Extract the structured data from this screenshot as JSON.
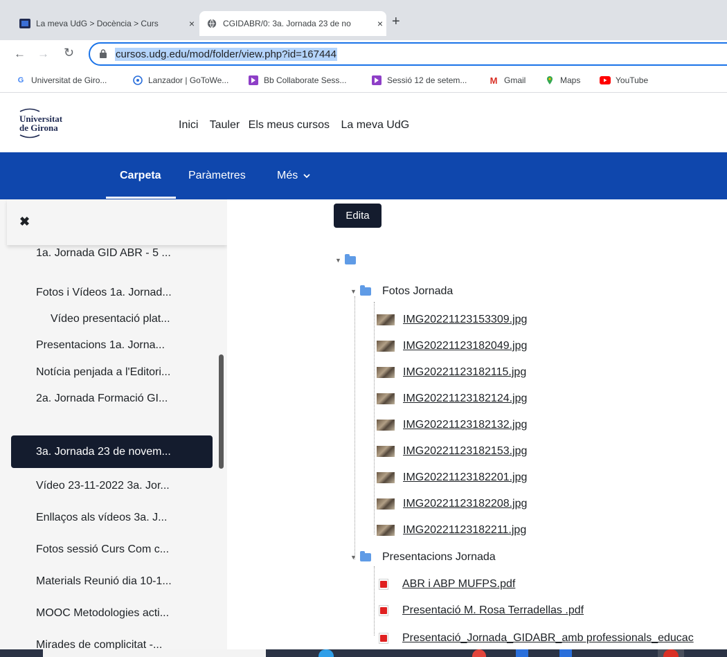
{
  "browser": {
    "tabs": [
      {
        "title": "La meva UdG > Docència > Curs",
        "close": "×"
      },
      {
        "title": "CGIDABR/0: 3a. Jornada 23 de no",
        "close": "×"
      }
    ],
    "new_tab": "+",
    "url": "cursos.udg.edu/mod/folder/view.php?id=167444",
    "bookmarks": [
      {
        "label": "Universitat de Giro...",
        "icon": "google-icon"
      },
      {
        "label": "Lanzador | GoToWe...",
        "icon": "gotowebinar-icon"
      },
      {
        "label": "Bb Collaborate Sess...",
        "icon": "collaborate-icon"
      },
      {
        "label": "Sessió 12 de setem...",
        "icon": "collaborate-icon"
      },
      {
        "label": "Gmail",
        "icon": "gmail-icon"
      },
      {
        "label": "Maps",
        "icon": "maps-icon"
      },
      {
        "label": "YouTube",
        "icon": "youtube-icon"
      }
    ]
  },
  "site": {
    "logo_line1": "Universitat",
    "logo_line2": "de Girona",
    "nav": [
      "Inici",
      "Tauler",
      "Els meus cursos",
      "La meva UdG"
    ]
  },
  "secondary_nav": {
    "items": [
      "Carpeta",
      "Paràmetres",
      "Més"
    ],
    "more_chevron": "⌄"
  },
  "drawer": {
    "close": "✖",
    "items": [
      {
        "label": "1a. Jornada GID ABR - 5 ..."
      },
      {
        "label": "Fotos i Vídeos 1a. Jornad..."
      },
      {
        "label": "Vídeo presentació plat..."
      },
      {
        "label": "Presentacions 1a. Jorna..."
      },
      {
        "label": "Notícia penjada a l'Editori..."
      },
      {
        "label": "2a. Jornada Formació GI..."
      },
      {
        "label": "3a. Jornada 23 de novem..."
      },
      {
        "label": "Vídeo 23-11-2022 3a. Jor..."
      },
      {
        "label": "Enllaços als vídeos 3a. J..."
      },
      {
        "label": "Fotos sessió Curs Com c..."
      },
      {
        "label": "Materials Reunió dia 10-1..."
      },
      {
        "label": "MOOC Metodologies acti..."
      },
      {
        "label": "Mirades de complicitat -..."
      }
    ]
  },
  "main": {
    "edit_button": "Edita",
    "folders": [
      {
        "name": "Fotos Jornada",
        "files": [
          "IMG20221123153309.jpg",
          "IMG20221123182049.jpg",
          "IMG20221123182115.jpg",
          "IMG20221123182124.jpg",
          "IMG20221123182132.jpg",
          "IMG20221123182153.jpg",
          "IMG20221123182201.jpg",
          "IMG20221123182208.jpg",
          "IMG20221123182211.jpg"
        ]
      },
      {
        "name": "Presentacions Jornada",
        "files": [
          "ABR i ABP MUFPS.pdf",
          "Presentació M. Rosa Terradellas .pdf",
          "Presentació_Jornada_GIDABR_amb professionals_educac"
        ]
      }
    ]
  }
}
